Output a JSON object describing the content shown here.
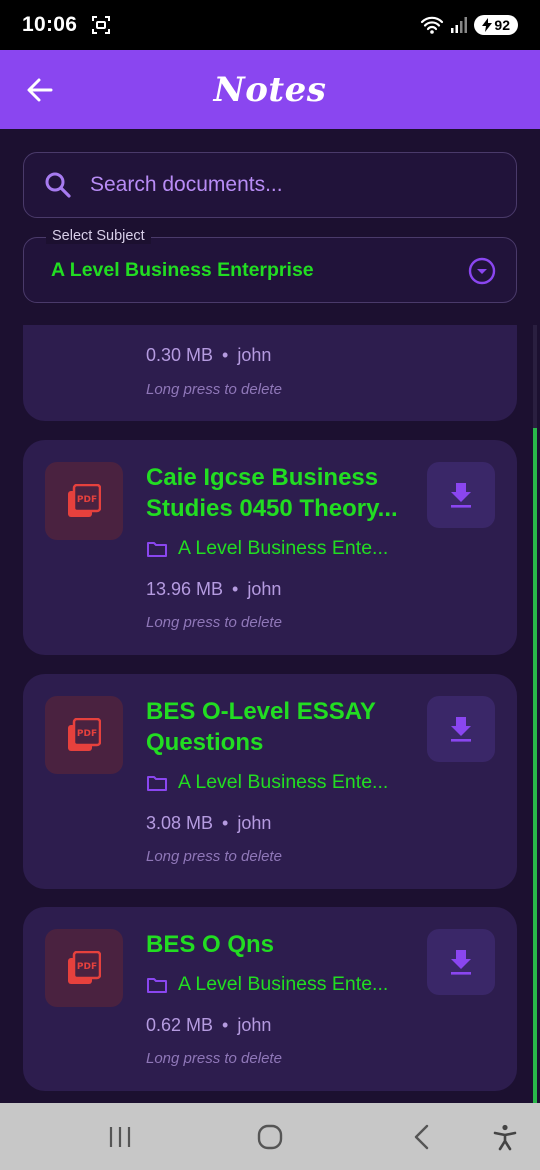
{
  "status": {
    "time": "10:06",
    "battery": "92"
  },
  "header": {
    "title": "Notes"
  },
  "search": {
    "placeholder": "Search documents..."
  },
  "subject": {
    "label": "Select Subject",
    "value": "A Level Business Enterprise"
  },
  "documents": [
    {
      "size": "0.30 MB",
      "owner": "john",
      "hint": "Long press to delete"
    },
    {
      "title": "Caie Igcse Business Studies 0450 Theory...",
      "subject": "A Level Business Ente...",
      "size": "13.96 MB",
      "owner": "john",
      "hint": "Long press to delete",
      "icon_text": "PDF"
    },
    {
      "title": "BES O-Level ESSAY Questions",
      "subject": "A Level Business Ente...",
      "size": "3.08 MB",
      "owner": "john",
      "hint": "Long press to delete",
      "icon_text": "PDF"
    },
    {
      "title": "BES O Qns",
      "subject": "A Level Business Ente...",
      "size": "0.62 MB",
      "owner": "john",
      "hint": "Long press to delete",
      "icon_text": "PDF"
    }
  ],
  "colors": {
    "accent": "#8a46f0",
    "green": "#22dd22",
    "card": "#2d1d4e",
    "background": "#1c1030"
  },
  "icons": [
    "back-arrow-icon",
    "search-icon",
    "dropdown-icon",
    "pdf-icon",
    "download-icon",
    "folder-icon",
    "recent-apps-icon",
    "home-icon",
    "back-icon",
    "accessibility-icon"
  ]
}
